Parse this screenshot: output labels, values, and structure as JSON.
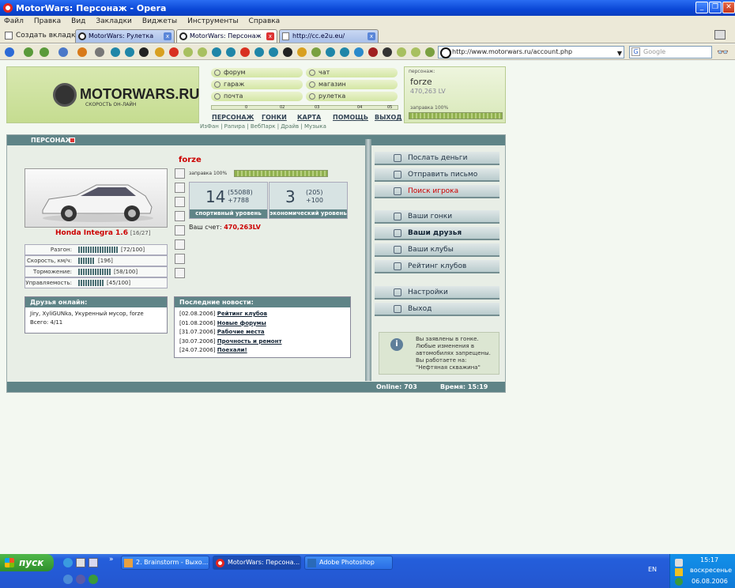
{
  "window": {
    "title": "MotorWars: Персонаж - Opera"
  },
  "menu": [
    "Файл",
    "Правка",
    "Вид",
    "Закладки",
    "Виджеты",
    "Инструменты",
    "Справка"
  ],
  "tabs": {
    "new_tab": "Создать вкладку",
    "items": [
      "MotorWars: Рулетка",
      "MotorWars: Персонаж",
      "http://cc.e2u.eu/"
    ]
  },
  "toolbar": {
    "address": "http://www.motorwars.ru/account.php",
    "search_placeholder": "Google"
  },
  "site": {
    "logo_name": "MOTORWARS.RU",
    "logo_slogan": "СКОРОСТЬ ОН-ЛАЙН",
    "menu_buttons": [
      "форум",
      "чат",
      "гараж",
      "магазин",
      "почта",
      "рулетка"
    ],
    "nav": [
      "ПЕРСОНАЖ",
      "ГОНКИ",
      "КАРТА",
      "ПОМОЩЬ",
      "ВЫХОД"
    ],
    "sublinks": "ИзФан | Рапира | ВебПарк | Драйв | Музыка",
    "scale_ticks": [
      "0",
      "01",
      "02",
      "03",
      "04",
      "05"
    ],
    "user": {
      "label": "персонаж:",
      "name": "forze",
      "money": "470,263 LV",
      "fuel": "заправка 100%",
      "fuel_level": 1.0
    }
  },
  "panel": {
    "title": "ПЕРСОНАЖ",
    "player": "forze",
    "fuel": "заправка 100%",
    "car_name": "Honda Integra 1.6",
    "car_num": "[16/27]",
    "stats": [
      {
        "label": "Разгон:",
        "value": "[72/100]",
        "level": 0.72
      },
      {
        "label": "Скорость, км/ч:",
        "value": "[196]",
        "level": 0.3
      },
      {
        "label": "Торможение:",
        "value": "[58/100]",
        "level": 0.58
      },
      {
        "label": "Управляемость:",
        "value": "[45/100]",
        "level": 0.45
      }
    ],
    "sport": {
      "level": "14",
      "exp": "(55088)",
      "gain": "+7788",
      "caption": "спортивный уровень"
    },
    "econ": {
      "level": "3",
      "exp": "(205)",
      "gain": "+100",
      "caption": "экономический уровень"
    },
    "account_label": "Ваш счет:",
    "account_value": "470,263LV",
    "friends": {
      "title": "Друзья онлайн:",
      "list": "Jiry, XyliGUNka, Укуренный мусор, forze",
      "total": "Всего: 4/11"
    },
    "news": {
      "title": "Последние новости:",
      "items": [
        {
          "date": "[02.08.2006]",
          "text": "Рейтинг клубов"
        },
        {
          "date": "[01.08.2006]",
          "text": "Новые форумы"
        },
        {
          "date": "[31.07.2006]",
          "text": "Рабочие места"
        },
        {
          "date": "[30.07.2006]",
          "text": "Прочность и ремонт"
        },
        {
          "date": "[24.07.2006]",
          "text": "Поехали!"
        }
      ]
    },
    "right_menu": [
      "Послать деньги",
      "Отправить письмо",
      "Поиск игрока",
      "Ваши гонки",
      "Ваши друзья",
      "Ваши клубы",
      "Рейтинг клубов",
      "Настройки",
      "Выход"
    ],
    "info": "Вы заявлены в гонке. Любые изменения в автомобилях запрещены. Вы работаете на: \"Нефтяная скважина\"",
    "online": "Online: 703",
    "time": "Время: 15:19"
  },
  "taskbar": {
    "start": "пуск",
    "tasks": [
      "2. Brainstorm - Выхо...",
      "MotorWars: Персона...",
      "Adobe Photoshop"
    ],
    "lang": "EN",
    "clock": "15:17",
    "day": "воскресенье",
    "date": "06.08.2006"
  }
}
